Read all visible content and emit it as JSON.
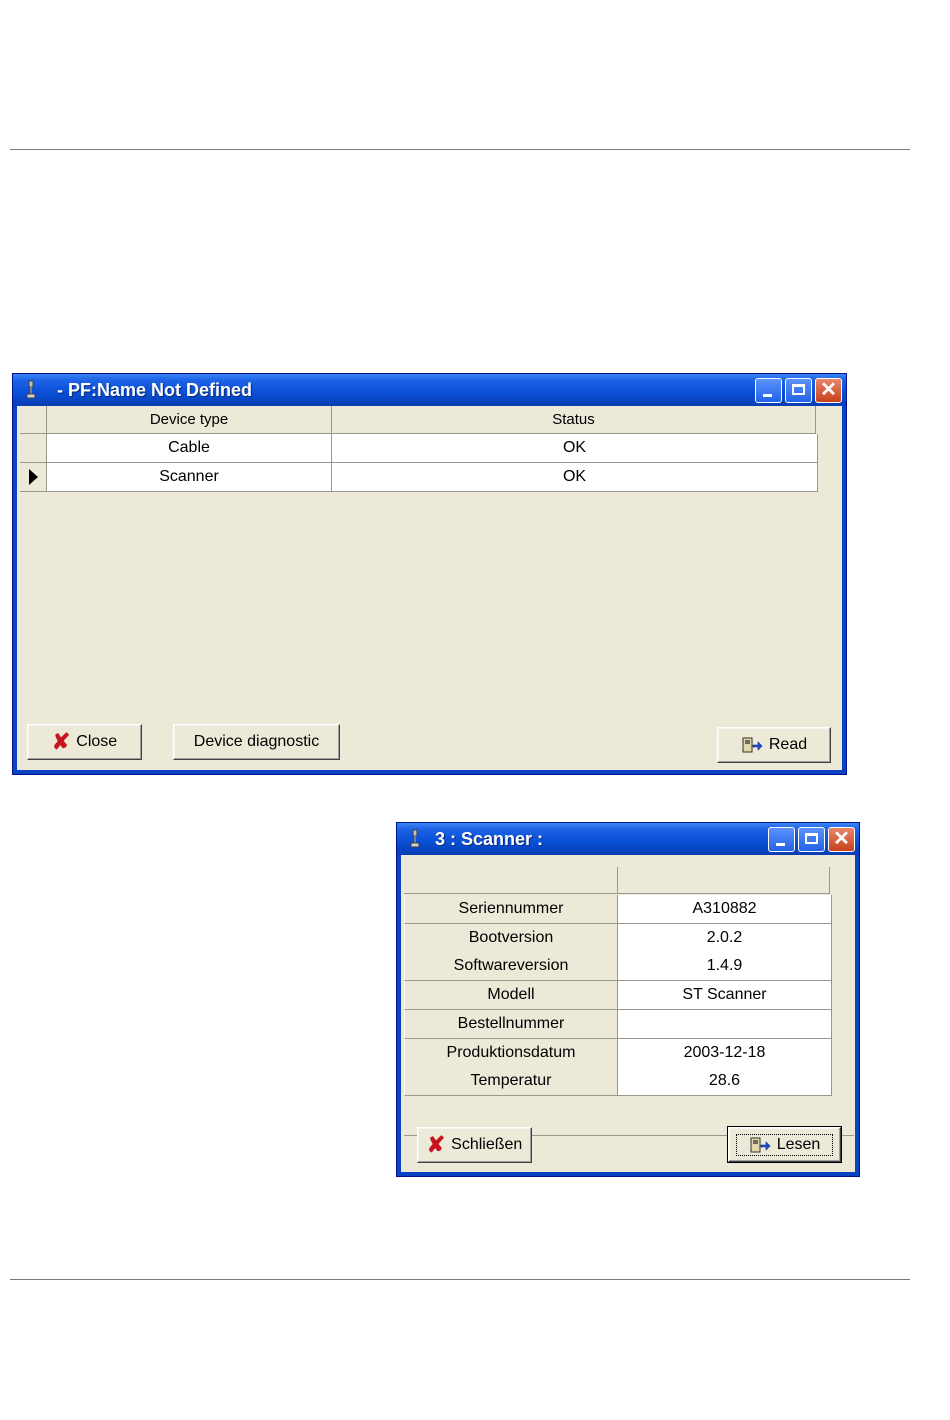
{
  "window1": {
    "title": "- PF:Name Not Defined",
    "columns": [
      "Device type",
      "Status"
    ],
    "rows": [
      {
        "device_type": "Cable",
        "status": "OK"
      },
      {
        "device_type": "Scanner",
        "status": "OK"
      }
    ],
    "buttons": {
      "close": "Close",
      "diagnostic": "Device diagnostic",
      "read": "Read"
    }
  },
  "window2": {
    "title": "3 : Scanner :",
    "rows": [
      {
        "label": "Seriennummer",
        "value": "A310882"
      },
      {
        "label": "Bootversion",
        "value": "2.0.2"
      },
      {
        "label": "Softwareversion",
        "value": "1.4.9"
      },
      {
        "label": "Modell",
        "value": "ST Scanner"
      },
      {
        "label": "Bestellnummer",
        "value": ""
      },
      {
        "label": "Produktionsdatum",
        "value": "2003-12-18"
      },
      {
        "label": "Temperatur",
        "value": "28.6"
      }
    ],
    "buttons": {
      "close": "Schließen",
      "read": "Lesen"
    }
  },
  "colors": {
    "titlebar": "#0a50d8",
    "client": "#ece9d8",
    "close_icon": "#c8141c"
  }
}
